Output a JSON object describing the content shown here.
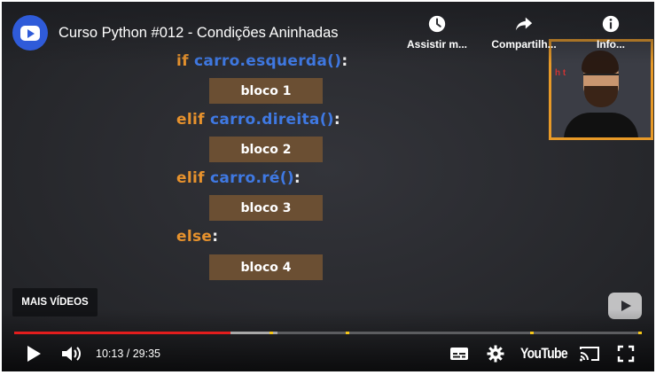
{
  "video": {
    "title": "Curso Python #012 - Condições Aninhadas"
  },
  "top_actions": [
    {
      "label": "Assistir m...",
      "icon": "clock-icon"
    },
    {
      "label": "Compartilh...",
      "icon": "share-icon"
    },
    {
      "label": "Info...",
      "icon": "info-icon"
    }
  ],
  "code": {
    "line1": {
      "kw": "if",
      "fn": "carro.esquerda()",
      "end": ":"
    },
    "block1": "bloco 1",
    "line2": {
      "kw": "elif",
      "fn": "carro.direita()",
      "end": ":"
    },
    "block2": "bloco 2",
    "line3": {
      "kw": "elif",
      "fn": "carro.ré()",
      "end": ":"
    },
    "block3": "bloco 3",
    "line4": {
      "kw": "else",
      "end": ":"
    },
    "block4": "bloco 4"
  },
  "webcam": {
    "sign_text": "h  t"
  },
  "overlay": {
    "more_videos_label": "MAIS VÍDEOS"
  },
  "player": {
    "current_time": "10:13",
    "duration": "29:35",
    "time_display": "10:13 / 29:35",
    "progress_played_fraction": 0.345,
    "buffered_fraction": 0.42,
    "brand_label": "YouTube"
  },
  "colors": {
    "keyword": "#e7922d",
    "function": "#3f79e3",
    "block_bg": "#6b4f33",
    "progress_played": "#e31d1d",
    "chapter_marker": "#f5c518",
    "webcam_border": "#e89a28"
  }
}
